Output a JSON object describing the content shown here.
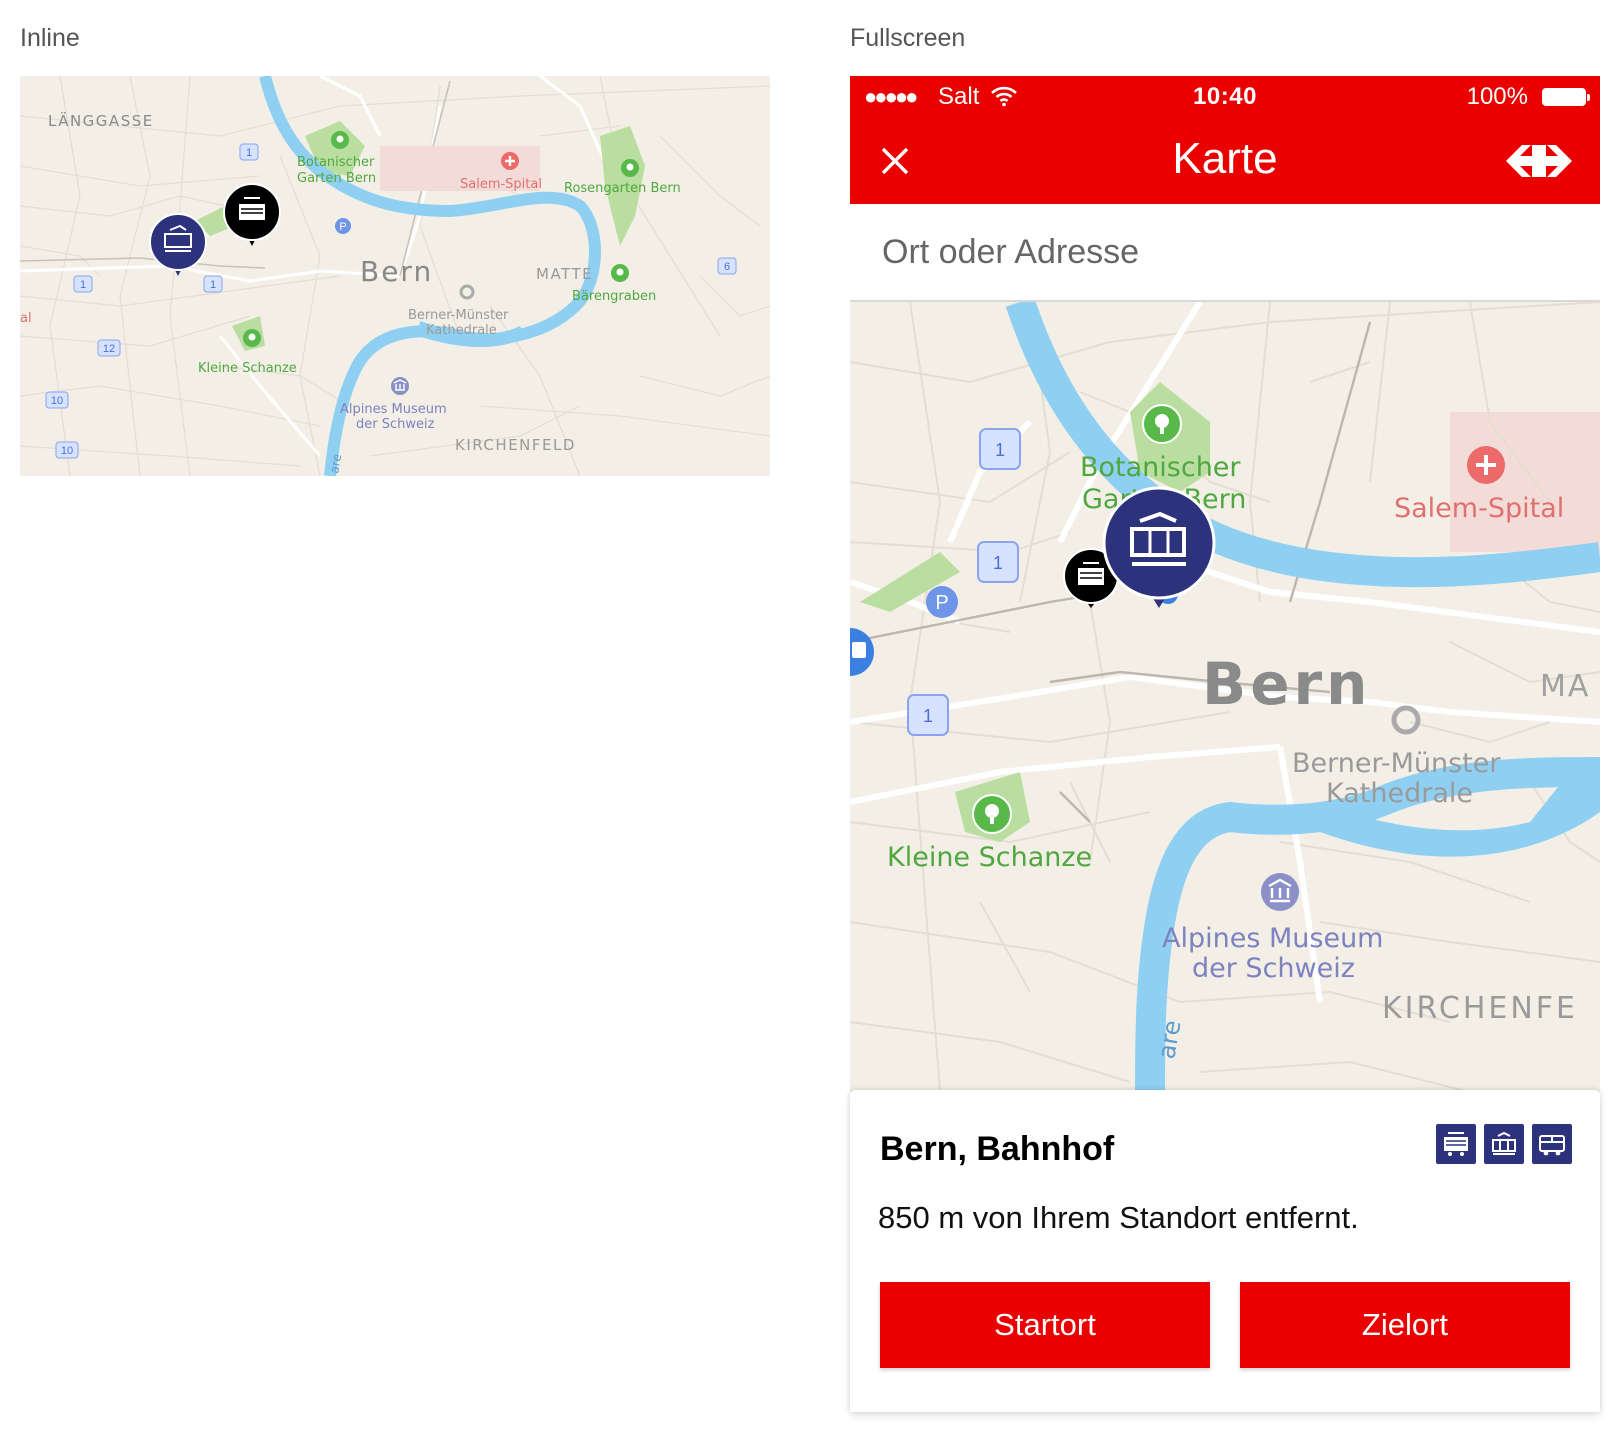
{
  "labels": {
    "inline": "Inline",
    "fullscreen": "Fullscreen"
  },
  "colors": {
    "sbb_red": "#eb0000",
    "station_blue": "#2d327d",
    "water": "#8fd0f2",
    "park": "#b9dea0",
    "map_bg": "#f3efe7"
  },
  "inline_map": {
    "labels": {
      "district_laenggasse": "LÄNGGASSE",
      "botanic_1": "Botanischer",
      "botanic_2": "Garten Bern",
      "salem": "Salem-Spital",
      "rosengarten": "Rosengarten Bern",
      "city": "Bern",
      "matte": "MATTE",
      "baerengraben": "Bärengraben",
      "muenster_1": "Berner-Münster",
      "muenster_2": "Kathedrale",
      "kleine_schanze": "Kleine Schanze",
      "alpines_1": "Alpines Museum",
      "alpines_2": "der Schweiz",
      "kirchenfeld": "KIRCHENFELD",
      "edge_left": "al",
      "aare": "are",
      "route_1": "1",
      "route_6": "6",
      "route_10": "10",
      "route_12": "12",
      "parking": "P"
    }
  },
  "status_bar": {
    "signal": "●●●●●",
    "carrier": "Salt",
    "time": "10:40",
    "battery": "100%"
  },
  "nav": {
    "title": "Karte",
    "close_icon": "close-icon",
    "logo_icon": "sbb-logo-icon"
  },
  "search": {
    "placeholder": "Ort oder Adresse",
    "value": ""
  },
  "full_map": {
    "labels": {
      "botanic_1": "Botanischer",
      "botanic_2": "Garten Bern",
      "salem": "Salem-Spital",
      "city": "Bern",
      "matte_partial": "MA",
      "muenster_1": "Berner-Münster",
      "muenster_2": "Kathedrale",
      "kleine_schanze": "Kleine Schanze",
      "alpines_1": "Alpines Museum",
      "alpines_2": "der Schweiz",
      "kirchenfeld_partial": "KIRCHENFE",
      "aare": "are",
      "route_1": "1",
      "parking": "P"
    }
  },
  "station_card": {
    "name": "Bern, Bahnhof",
    "distance": "850 m von Ihrem Standort entfernt.",
    "transport_icons": [
      "train-icon",
      "tram-icon",
      "bus-icon"
    ],
    "start_label": "Startort",
    "destination_label": "Zielort"
  }
}
